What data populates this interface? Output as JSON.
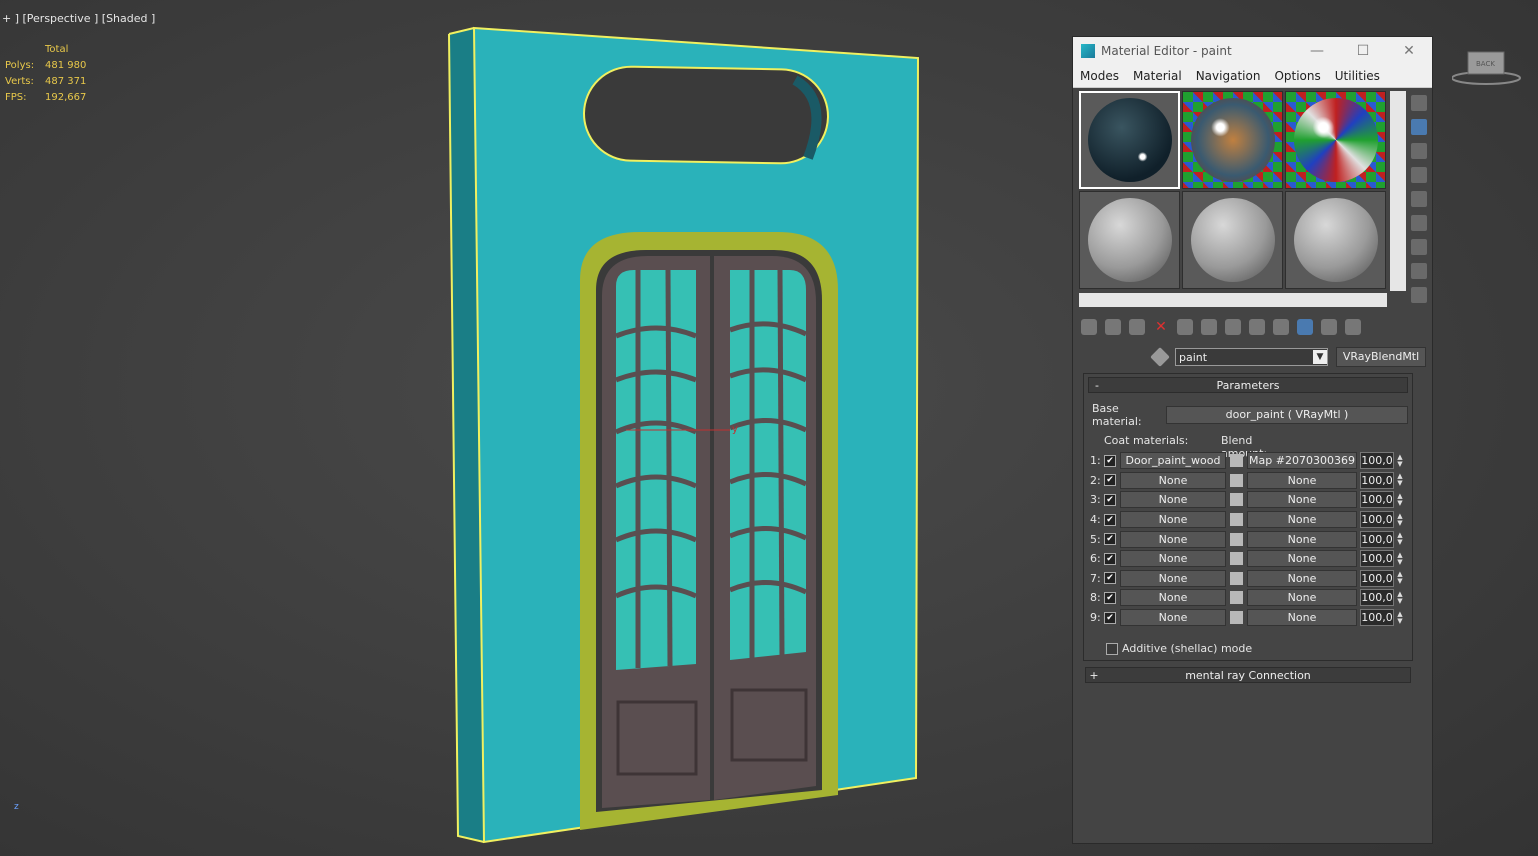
{
  "viewport": {
    "label": "+ ] [Perspective ] [Shaded ]",
    "stats": {
      "header": "Total",
      "polys_label": "Polys:",
      "polys": "481 980",
      "verts_label": "Verts:",
      "verts": "487 371",
      "fps_label": "FPS:",
      "fps": "192,667"
    },
    "axis_z": "z",
    "axis_y": "y",
    "viewcube_label": "BACK"
  },
  "material_editor": {
    "title": "Material Editor - paint",
    "menu": [
      "Modes",
      "Material",
      "Navigation",
      "Options",
      "Utilities"
    ],
    "material_name": "paint",
    "material_type": "VRayBlendMtl",
    "parameters": {
      "title": "Parameters",
      "base_label": "Base material:",
      "base_value": "door_paint  ( VRayMtl )",
      "coat_header": "Coat materials:",
      "blend_header": "Blend amount:",
      "coats": [
        {
          "idx": "1:",
          "material": "Door_paint_wood",
          "map": "Map #2070300369",
          "amount": "100,0"
        },
        {
          "idx": "2:",
          "material": "None",
          "map": "None",
          "amount": "100,0"
        },
        {
          "idx": "3:",
          "material": "None",
          "map": "None",
          "amount": "100,0"
        },
        {
          "idx": "4:",
          "material": "None",
          "map": "None",
          "amount": "100,0"
        },
        {
          "idx": "5:",
          "material": "None",
          "map": "None",
          "amount": "100,0"
        },
        {
          "idx": "6:",
          "material": "None",
          "map": "None",
          "amount": "100,0"
        },
        {
          "idx": "7:",
          "material": "None",
          "map": "None",
          "amount": "100,0"
        },
        {
          "idx": "8:",
          "material": "None",
          "map": "None",
          "amount": "100,0"
        },
        {
          "idx": "9:",
          "material": "None",
          "map": "None",
          "amount": "100,0"
        }
      ],
      "additive_label": "Additive (shellac) mode"
    },
    "mental_ray": "mental ray Connection"
  },
  "colors": {
    "wall": "#28b0b8",
    "frame": "#a6b432",
    "door": "#5a4e50",
    "glass": "#36c0b4",
    "selection": "#f0f060"
  }
}
